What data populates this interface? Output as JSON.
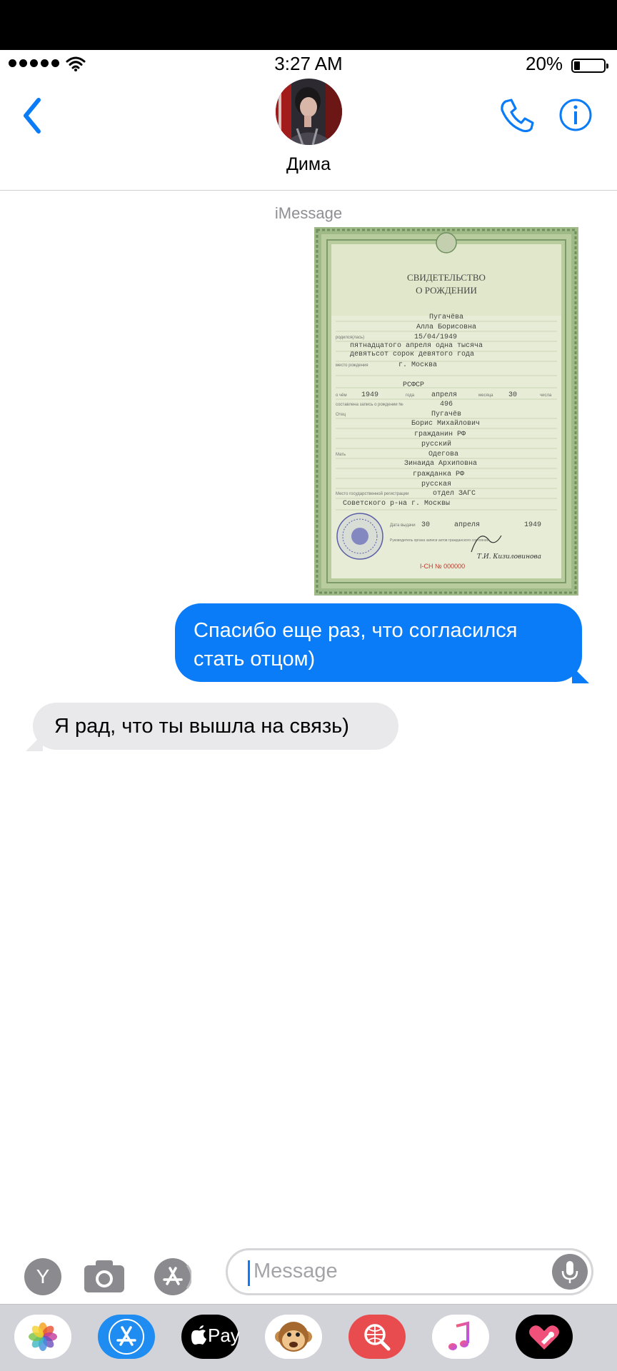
{
  "status_bar": {
    "time": "3:27 AM",
    "battery_percent": "20%",
    "battery_level": 0.2,
    "signal_bars": 5
  },
  "header": {
    "contact_name": "Дима",
    "icons": [
      "back-chevron-icon",
      "avatar",
      "phone-icon",
      "info-icon"
    ]
  },
  "conversation": {
    "service_label": "iMessage",
    "attachment": {
      "type": "image",
      "document": {
        "title_line1": "СВИДЕТЕЛЬСТВО",
        "title_line2": "О РОЖДЕНИИ",
        "surname": "Пугачёва",
        "given_names": "Алла Борисовна",
        "born_label": "родился(лась)",
        "birth_date": "15/04/1949",
        "birth_date_words_1": "пятнадцатого апреля одна тысяча",
        "birth_date_words_2": "девятьсот сорок девятого года",
        "place_label": "место рождения",
        "place": "г. Москва",
        "republic": "РСФСР",
        "record_prefix": "о чём",
        "record_year": "1949",
        "year_word": "года",
        "record_month": "апреля",
        "month_word": "месяца",
        "record_day": "30",
        "day_word": "числа",
        "record_line_label": "составлена запись о рождении №",
        "record_number": "496",
        "father_label": "Отец",
        "father_surname": "Пугачёв",
        "father_names": "Борис Михайлович",
        "father_citizenship": "гражданин РФ",
        "father_nationality": "русский",
        "mother_label": "Мать",
        "mother_surname": "Одегова",
        "mother_names": "Зинаида Архиповна",
        "mother_citizenship": "гражданка РФ",
        "mother_nationality": "русская",
        "registry_label": "Место государственной регистрации",
        "registry_1": "отдел ЗАГС",
        "registry_2": "Советского р-на г. Москвы",
        "issue_label": "Дата выдачи",
        "issue_day": "30",
        "issue_month": "апреля",
        "issue_year": "1949",
        "head_label": "Руководитель органа записи актов гражданского состояния",
        "signature_name": "Т.И. Кизиловинова",
        "serial": "I-СН № 000000"
      }
    },
    "messages": [
      {
        "direction": "outgoing",
        "text_line1": "Спасибо еще раз, что согласился",
        "text_line2": "стать отцом)"
      },
      {
        "direction": "incoming",
        "text": "Я рад, что ты вышла на связь)"
      }
    ]
  },
  "composer": {
    "placeholder": "Message",
    "left_buttons": [
      "Y",
      "camera-icon",
      "app-store-icon"
    ],
    "mic": "microphone-icon"
  },
  "dock": {
    "apps": [
      "photos-app-icon",
      "app-store-app-icon",
      "apple-pay-app-icon",
      "animoji-app-icon",
      "web-search-app-icon",
      "music-app-icon",
      "digital-touch-app-icon"
    ],
    "apple_pay_label": "Pay"
  },
  "colors": {
    "accent": "#0b7cf7",
    "outgoing_bubble": "#0b7cf7",
    "incoming_bubble": "#e9e9eb",
    "certificate_green": "#9fb987"
  }
}
